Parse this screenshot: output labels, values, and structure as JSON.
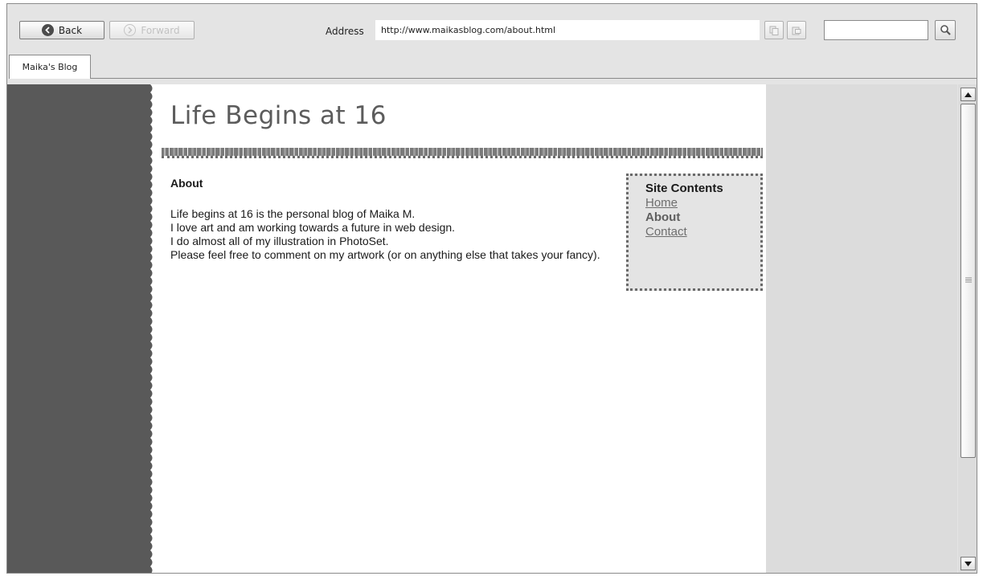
{
  "browser": {
    "back_label": "Back",
    "forward_label": "Forward",
    "address_label": "Address",
    "address_value": "http://www.maikasblog.com/about.html",
    "search_value": "",
    "tab_label": "Maika's Blog"
  },
  "page": {
    "title": "Life Begins at 16",
    "section_heading": "About",
    "paragraph_lines": [
      "Life begins at 16 is the personal blog of Maika M.",
      "I love art and am working towards a future in web design.",
      "I do almost all of my illustration in PhotoSet.",
      "Please feel free to comment on my artwork (or on anything else that takes your fancy)."
    ],
    "site_contents": {
      "heading": "Site Contents",
      "home_link": "Home",
      "current_page": "About",
      "contact_link": "Contact"
    }
  },
  "colors": {
    "left_gutter": "#595959",
    "page_background": "#ffffff",
    "chrome_background": "#e4e4e4",
    "link_gray": "#6e6e6e"
  },
  "icons": {
    "back": "circle-left-arrow-icon",
    "forward": "circle-right-arrow-icon",
    "copy": "copy-icon",
    "paste": "paste-icon",
    "search": "magnifier-icon",
    "scroll_up": "arrow-up-icon",
    "scroll_down": "arrow-down-icon"
  }
}
